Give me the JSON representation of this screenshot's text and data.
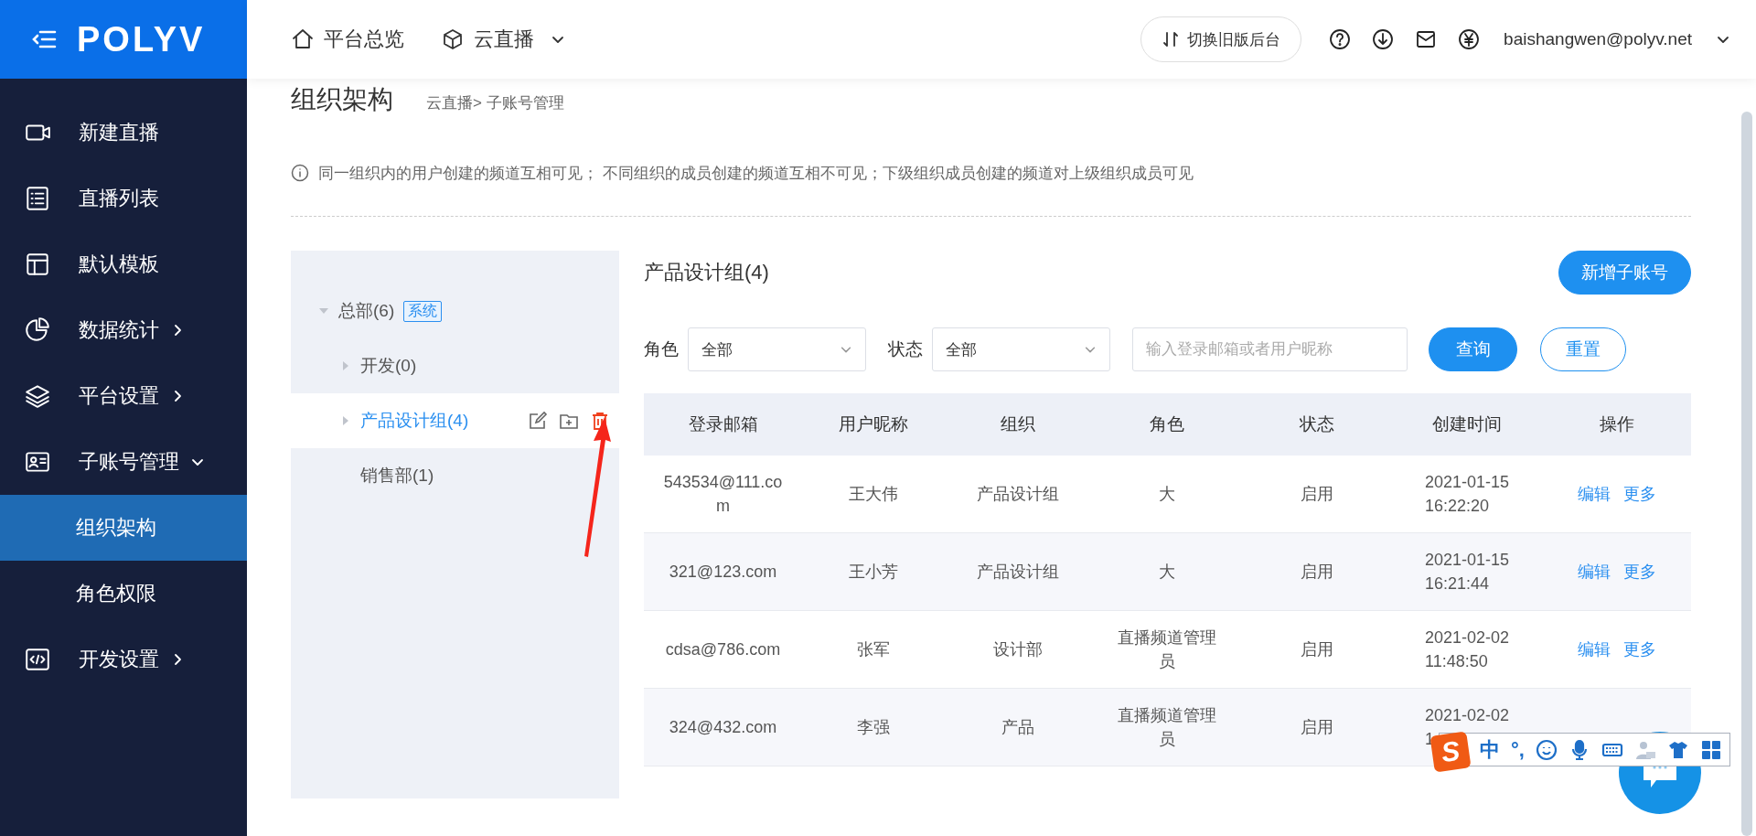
{
  "sidebar": {
    "logo": "POLYV",
    "items": [
      {
        "label": "新建直播",
        "kind": "link",
        "selected": false
      },
      {
        "label": "直播列表",
        "kind": "link",
        "selected": false
      },
      {
        "label": "默认模板",
        "kind": "link",
        "selected": false
      },
      {
        "label": "数据统计",
        "kind": "menu",
        "expanded": false,
        "selected": false
      },
      {
        "label": "平台设置",
        "kind": "menu",
        "expanded": false,
        "selected": false
      },
      {
        "label": "子账号管理",
        "kind": "menu",
        "expanded": true,
        "selected": false,
        "children": [
          {
            "label": "组织架构",
            "selected": true
          },
          {
            "label": "角色权限",
            "selected": false
          }
        ]
      },
      {
        "label": "开发设置",
        "kind": "menu",
        "expanded": false,
        "selected": false
      }
    ]
  },
  "topbar": {
    "nav": [
      {
        "label": "平台总览",
        "has_menu": false
      },
      {
        "label": "云直播",
        "has_menu": true
      }
    ],
    "switch_button": "切换旧版后台",
    "user": "baishangwen@polyv.net"
  },
  "page": {
    "title": "组织架构",
    "breadcrumb": "云直播> 子账号管理",
    "notice": "同一组织内的用户创建的频道互相可见； 不同组织的成员创建的频道互相不可见；下级组织成员创建的频道对上级组织成员可见"
  },
  "tree": {
    "items": [
      {
        "label": "总部(6)",
        "tag": "系统",
        "kind": "branch",
        "expanded": true,
        "selected": false,
        "children": [
          {
            "label": "开发(0)",
            "kind": "branch",
            "expanded": false,
            "selected": false
          },
          {
            "label": "产品设计组(4)",
            "kind": "branch",
            "expanded": false,
            "selected": true
          },
          {
            "label": "销售部(1)",
            "kind": "leaf",
            "selected": false
          }
        ]
      }
    ]
  },
  "panel": {
    "title": "产品设计组(4)",
    "add_button": "新增子账号",
    "filters": [
      {
        "label": "角色",
        "value": "全部"
      },
      {
        "label": "状态",
        "value": "全部"
      }
    ],
    "search": {
      "placeholder": "输入登录邮箱或者用户昵称"
    },
    "query_button": "查询",
    "reset_button": "重置"
  },
  "table": {
    "columns": [
      "登录邮箱",
      "用户昵称",
      "组织",
      "角色",
      "状态",
      "创建时间",
      "操作"
    ],
    "rows": [
      {
        "email": "543534@111.com",
        "nickname": "王大伟",
        "org": "产品设计组",
        "role": "大",
        "status": "启用",
        "created": "2021-01-15\n16:22:20",
        "actions": [
          "编辑",
          "更多"
        ]
      },
      {
        "email": "321@123.com",
        "nickname": "王小芳",
        "org": "产品设计组",
        "role": "大",
        "status": "启用",
        "created": "2021-01-15\n16:21:44",
        "actions": [
          "编辑",
          "更多"
        ]
      },
      {
        "email": "cdsa@786.com",
        "nickname": "张军",
        "org": "设计部",
        "role": "直播频道管理员",
        "status": "启用",
        "created": "2021-02-02\n11:48:50",
        "actions": [
          "编辑",
          "更多"
        ]
      },
      {
        "email": "324@432.com",
        "nickname": "李强",
        "org": "产品",
        "role": "直播频道管理员",
        "status": "启用",
        "created": "2021-02-02\n1"
      }
    ]
  },
  "ime_toolbar": {
    "logo": "S",
    "mode": "中",
    "punctuation": "°,"
  }
}
